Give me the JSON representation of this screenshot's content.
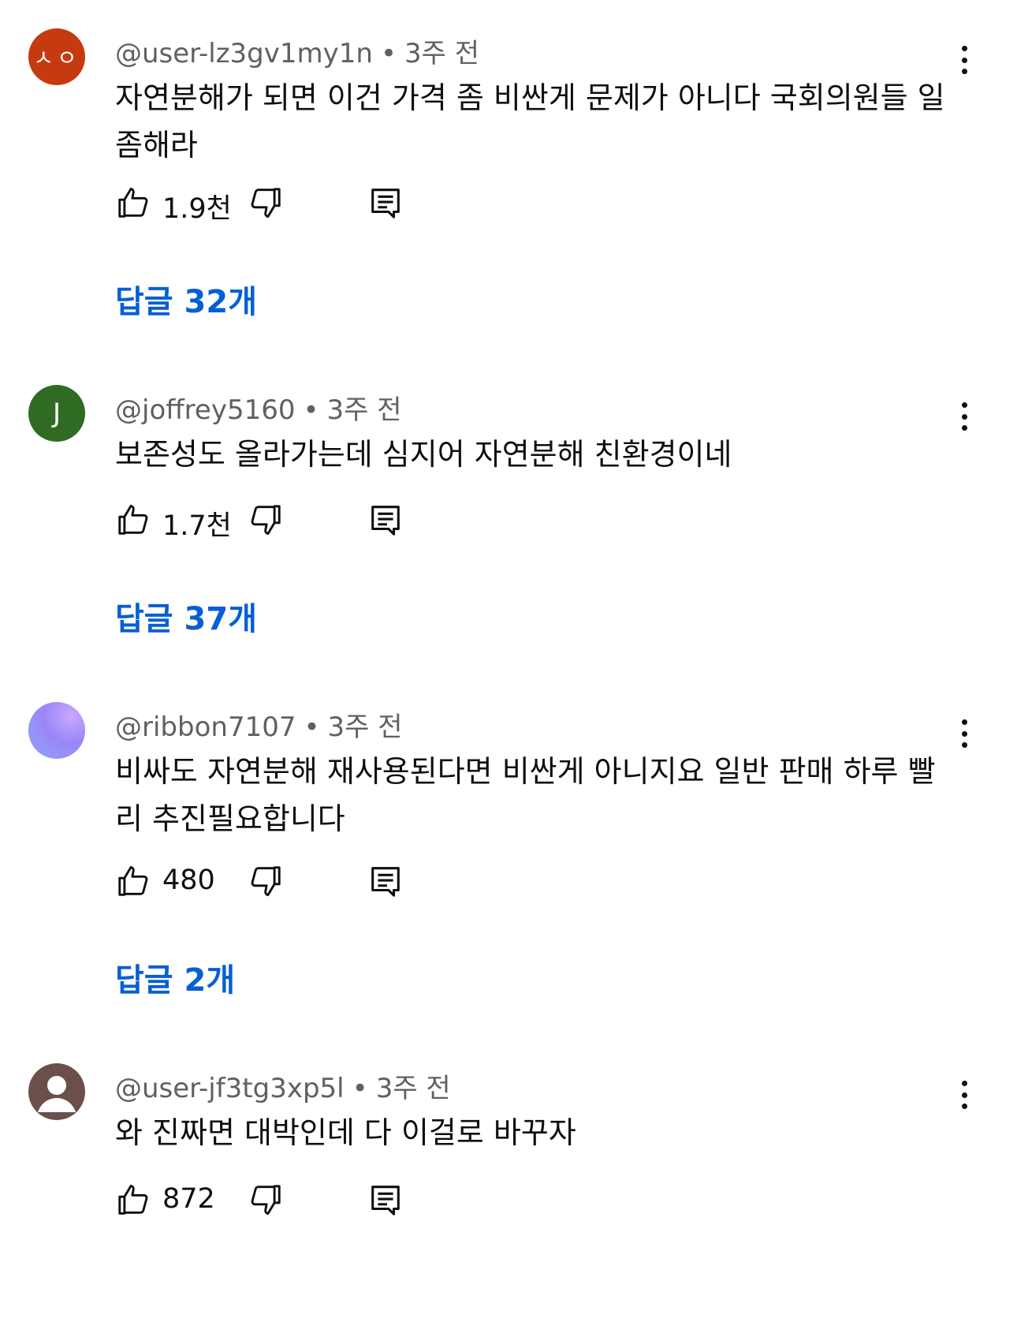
{
  "comments": [
    {
      "avatar_text": "ㅅㅇ",
      "avatar_color": "#c63a12",
      "handle": "@user-lz3gv1my1n",
      "separator": "•",
      "time": "3주 전",
      "text": "자연분해가 되면 이건 가격 좀 비싼게 문제가 아니다 국회의원들 일좀해라",
      "likes": "1.9천",
      "replies_label": "답글 32개"
    },
    {
      "avatar_text": "J",
      "avatar_color": "#2f6b22",
      "handle": "@joffrey5160",
      "separator": "•",
      "time": "3주 전",
      "text": "보존성도 올라가는데 심지어 자연분해 친환경이네",
      "likes": "1.7천",
      "replies_label": "답글 37개"
    },
    {
      "avatar_text": "",
      "avatar_color": "#a78bfa",
      "handle": "@ribbon7107",
      "separator": "•",
      "time": "3주 전",
      "text": "비싸도 자연분해 재사용된다면 비싼게 아니지요 일반 판매 하루 빨리 추진필요합니다",
      "likes": "480",
      "replies_label": "답글 2개"
    },
    {
      "avatar_text": "",
      "avatar_color": "#6b4f4b",
      "handle": "@user-jf3tg3xp5l",
      "separator": "•",
      "time": "3주 전",
      "text": "와 진짜면 대박인데 다 이걸로 바꾸자",
      "likes": "872",
      "replies_label": ""
    }
  ],
  "icons": {
    "like": "thumbs-up-icon",
    "dislike": "thumbs-down-icon",
    "reply": "reply-comment-icon",
    "more": "more-vertical-icon"
  }
}
